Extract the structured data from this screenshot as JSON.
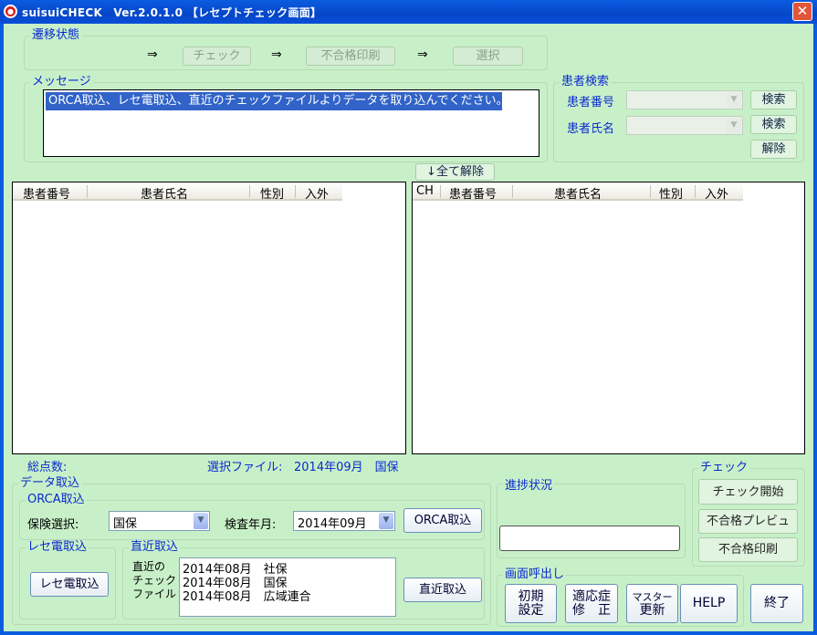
{
  "window": {
    "title": "suisuiCHECK　Ver.2.0.1.0 【レセプトチェック画面】",
    "close": "✕"
  },
  "transition": {
    "legend": "遷移状態",
    "arrow": "⇒",
    "check": "チェック",
    "fail_print": "不合格印刷",
    "select": "選択"
  },
  "message": {
    "legend": "メッセージ",
    "text": "ORCA取込、レセ電取込、直近のチェックファイルよりデータを取り込んでください。"
  },
  "patient_search": {
    "legend": "患者検索",
    "number_label": "患者番号",
    "name_label": "患者氏名",
    "search1": "検索",
    "search2": "検索",
    "clear": "解除"
  },
  "clear_all": "↓全て解除",
  "left_list": {
    "columns": [
      "患者番号",
      "患者氏名",
      "性別",
      "入外"
    ]
  },
  "right_list": {
    "columns": [
      "CH",
      "患者番号",
      "患者氏名",
      "性別",
      "入外"
    ]
  },
  "status": {
    "total_points_label": "総点数:",
    "selected_file_label": "選択ファイル:",
    "selected_file_value": "2014年09月　国保"
  },
  "data_import": {
    "legend": "データ取込",
    "orca": {
      "legend": "ORCA取込",
      "insurance_label": "保険選択:",
      "insurance_value": "国保",
      "month_label": "検査年月:",
      "month_value": "2014年09月",
      "button": "ORCA取込"
    },
    "rece": {
      "legend": "レセ電取込",
      "button": "レセ電取込"
    },
    "recent": {
      "legend": "直近取込",
      "label_lines": [
        "直近の",
        "チェック",
        "ファイル"
      ],
      "files": [
        "2014年08月　社保",
        "2014年08月　国保",
        "2014年08月　広域連合"
      ],
      "button": "直近取込"
    }
  },
  "progress": {
    "legend": "進捗状況"
  },
  "check": {
    "legend": "チェック",
    "start": "チェック開始",
    "preview": "不合格プレビュ",
    "print": "不合格印刷"
  },
  "screens": {
    "legend": "画面呼出し",
    "initial_1": "初期",
    "initial_2": "設定",
    "indication_1": "適応症",
    "indication_2": "修　正",
    "master_1": "マスター",
    "master_2": "更新",
    "help": "HELP"
  },
  "exit": "終了"
}
